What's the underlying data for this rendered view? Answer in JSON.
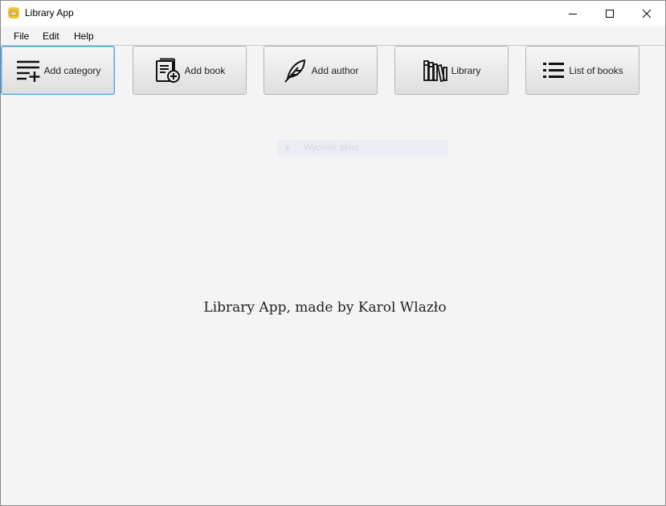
{
  "window": {
    "title": "Library App"
  },
  "menu": [
    "File",
    "Edit",
    "Help"
  ],
  "toolbar": [
    {
      "label": "Add category",
      "icon": "add-category-icon"
    },
    {
      "label": "Add book",
      "icon": "add-book-icon"
    },
    {
      "label": "Add author",
      "icon": "feather-icon"
    },
    {
      "label": "Library",
      "icon": "library-icon"
    },
    {
      "label": "List of books",
      "icon": "list-icon"
    }
  ],
  "overlay": {
    "label": "Wycinek okna"
  },
  "main": {
    "credit": "Library App, made by Karol Wlazło"
  }
}
